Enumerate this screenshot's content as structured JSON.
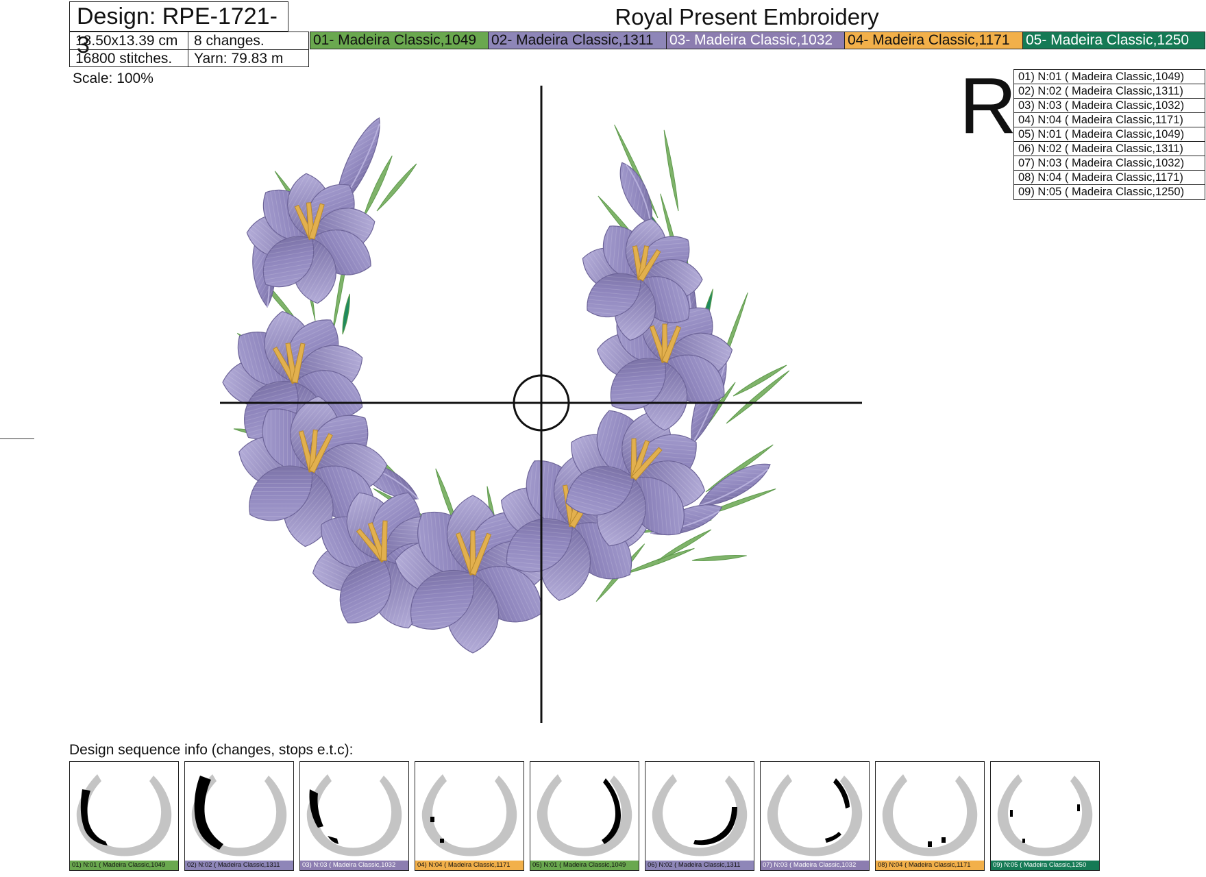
{
  "header": {
    "design_label": "Design: RPE-1721-3",
    "size": "13.50x13.39 cm",
    "changes": "8 changes.",
    "stitches": "16800 stitches.",
    "yarn": "Yarn: 79.83 m",
    "title": "Royal Present Embroidery",
    "scale": "Scale: 100%"
  },
  "threads": [
    {
      "label": "01- Madeira Classic,1049",
      "color": "#6aa84f",
      "text_dark": true
    },
    {
      "label": "02- Madeira Classic,1311",
      "color": "#8e86b8",
      "text_dark": true
    },
    {
      "label": "03- Madeira Classic,1032",
      "color": "#8c7db0",
      "text_dark": false
    },
    {
      "label": "04- Madeira Classic,1171",
      "color": "#f2b04a",
      "text_dark": true
    },
    {
      "label": "05- Madeira Classic,1250",
      "color": "#157a55",
      "text_dark": false
    }
  ],
  "r_letter": "R",
  "stop_sequence": [
    "01) N:01 ( Madeira Classic,1049)",
    "02) N:02 ( Madeira Classic,1311)",
    "03) N:03 ( Madeira Classic,1032)",
    "04) N:04 ( Madeira Classic,1171)",
    "05) N:01 ( Madeira Classic,1049)",
    "06) N:02 ( Madeira Classic,1311)",
    "07) N:03 ( Madeira Classic,1032)",
    "08) N:04 ( Madeira Classic,1171)",
    "09) N:05 ( Madeira Classic,1250)"
  ],
  "sequence_info_label": "Design sequence info (changes, stops e.t.c):",
  "thumbnails": [
    {
      "label": "01) N:01 ( Madeira Classic,1049",
      "color": "#6aa84f",
      "text_dark": true
    },
    {
      "label": "02) N:02 ( Madeira Classic,1311",
      "color": "#8e86b8",
      "text_dark": true
    },
    {
      "label": "03) N:03 ( Madeira Classic,1032",
      "color": "#8c7db0",
      "text_dark": false
    },
    {
      "label": "04) N:04 ( Madeira Classic,1171",
      "color": "#f2b04a",
      "text_dark": true
    },
    {
      "label": "05) N:01 ( Madeira Classic,1049",
      "color": "#6aa84f",
      "text_dark": true
    },
    {
      "label": "06) N:02 ( Madeira Classic,1311",
      "color": "#8e86b8",
      "text_dark": true
    },
    {
      "label": "07) N:03 ( Madeira Classic,1032",
      "color": "#8c7db0",
      "text_dark": false
    },
    {
      "label": "08) N:04 ( Madeira Classic,1171",
      "color": "#f2b04a",
      "text_dark": true
    },
    {
      "label": "09) N:05 ( Madeira Classic,1250",
      "color": "#157a55",
      "text_dark": false
    }
  ]
}
